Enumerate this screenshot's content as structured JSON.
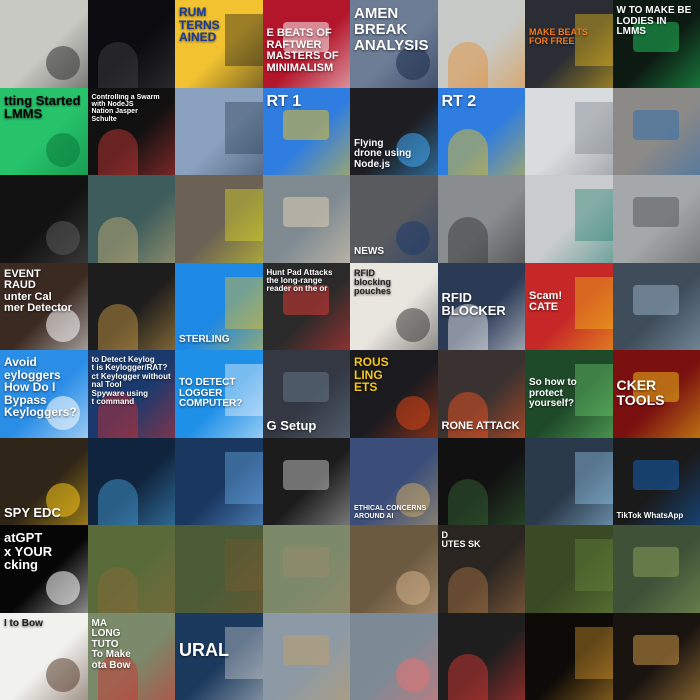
{
  "grid": {
    "columns": 8,
    "rows": 8,
    "tiles": [
      {
        "id": "r1c1",
        "label": "",
        "bg": "#c9c9c4",
        "accent": "#333333",
        "text_color": "#000000",
        "pos": "center",
        "size": 10
      },
      {
        "id": "r1c2",
        "label": "",
        "bg": "#0c0c10",
        "accent": "#444444",
        "text_color": "#ffffff",
        "pos": "center",
        "size": 10
      },
      {
        "id": "r1c3",
        "label": "RUM\nTERNS\nAINED",
        "bg": "#f2c230",
        "accent": "#1a1a1a",
        "text_color": "#1b3b9a",
        "pos": "top",
        "size": 12
      },
      {
        "id": "r1c4",
        "label": "E BEATS OF\nRAFTWER\nMASTERS OF MINIMALISM",
        "bg": "#b3162b",
        "accent": "#ffffff",
        "text_color": "#ffffff",
        "pos": "mid",
        "size": 11
      },
      {
        "id": "r1c5",
        "label": "AMEN\nBREAK\nANALYSIS",
        "bg": "#6d7d96",
        "accent": "#1b2c4a",
        "text_color": "#ffffff",
        "pos": "top",
        "size": 15
      },
      {
        "id": "r1c6",
        "label": "",
        "bg": "#c7cac6",
        "accent": "#e58a2c",
        "text_color": "#000000",
        "pos": "center",
        "size": 10
      },
      {
        "id": "r1c7",
        "label": "MAKE BEATS FOR FREE",
        "bg": "#2a2d33",
        "accent": "#f5c518",
        "text_color": "#f07c1c",
        "pos": "mid",
        "size": 9
      },
      {
        "id": "r1c8",
        "label": "W TO MAKE BE\nLODIES IN LMMS",
        "bg": "#0d1a12",
        "accent": "#22c55e",
        "text_color": "#ffffff",
        "pos": "top",
        "size": 10
      },
      {
        "id": "r2c1",
        "label": "tting Started\nLMMS",
        "bg": "#27c36b",
        "accent": "#0a7a3a",
        "text_color": "#000000",
        "pos": "top",
        "size": 13
      },
      {
        "id": "r2c2",
        "label": "Controlling a Swarm\nwith NodeJS\nNation  Jasper\nSchulte",
        "bg": "#111111",
        "accent": "#d63a3a",
        "text_color": "#ffffff",
        "pos": "top",
        "size": 7
      },
      {
        "id": "r2c3",
        "label": "",
        "bg": "#8aa1bf",
        "accent": "#2b3c55",
        "text_color": "#ffffff",
        "pos": "center",
        "size": 10
      },
      {
        "id": "r2c4",
        "label": "RT 1",
        "bg": "#2f7de0",
        "accent": "#f5c518",
        "text_color": "#ffffff",
        "pos": "top",
        "size": 16
      },
      {
        "id": "r2c5",
        "label": "Flying\ndrone using\nNode.js",
        "bg": "#1d1d22",
        "accent": "#3fa9f5",
        "text_color": "#ffffff",
        "pos": "bottom",
        "size": 10
      },
      {
        "id": "r2c6",
        "label": "RT 2",
        "bg": "#2f7de0",
        "accent": "#f5c518",
        "text_color": "#ffffff",
        "pos": "top",
        "size": 16
      },
      {
        "id": "r2c7",
        "label": "",
        "bg": "#d8dcdf",
        "accent": "#7a7f85",
        "text_color": "#000000",
        "pos": "center",
        "size": 10
      },
      {
        "id": "r2c8",
        "label": "",
        "bg": "#8c8a86",
        "accent": "#2b6cb0",
        "text_color": "#000000",
        "pos": "center",
        "size": 10
      },
      {
        "id": "r3c1",
        "label": "",
        "bg": "#121212",
        "accent": "#5a5a5a",
        "text_color": "#ffffff",
        "pos": "center",
        "size": 10
      },
      {
        "id": "r3c2",
        "label": "",
        "bg": "#3d5c5b",
        "accent": "#c9b37a",
        "text_color": "#ffffff",
        "pos": "center",
        "size": 10
      },
      {
        "id": "r3c3",
        "label": "",
        "bg": "#6b6255",
        "accent": "#e4e021",
        "text_color": "#ffffff",
        "pos": "center",
        "size": 10
      },
      {
        "id": "r3c4",
        "label": "",
        "bg": "#7f8b91",
        "accent": "#e7d3b8",
        "text_color": "#ffffff",
        "pos": "center",
        "size": 10
      },
      {
        "id": "r3c5",
        "label": "NEWS",
        "bg": "#585a5e",
        "accent": "#1f3b6b",
        "text_color": "#ffffff",
        "pos": "bottom",
        "size": 10
      },
      {
        "id": "r3c6",
        "label": "",
        "bg": "#8a8d90",
        "accent": "#2c2c2c",
        "text_color": "#ffffff",
        "pos": "center",
        "size": 10
      },
      {
        "id": "r3c7",
        "label": "",
        "bg": "#c9cbcc",
        "accent": "#1e7f6e",
        "text_color": "#ffffff",
        "pos": "center",
        "size": 10
      },
      {
        "id": "r3c8",
        "label": "",
        "bg": "#a5a8aa",
        "accent": "#505050",
        "text_color": "#ffffff",
        "pos": "center",
        "size": 10
      },
      {
        "id": "r4c1",
        "label": "EVENT\nRAUD\nunter Cal\nmer Detector",
        "bg": "#3b2a22",
        "accent": "#ffffff",
        "text_color": "#ffffff",
        "pos": "top",
        "size": 11
      },
      {
        "id": "r4c2",
        "label": "",
        "bg": "#1d1d1d",
        "accent": "#d7a44a",
        "text_color": "#ffffff",
        "pos": "center",
        "size": 10
      },
      {
        "id": "r4c3",
        "label": "STERLING",
        "bg": "#1e88e5",
        "accent": "#f5c518",
        "text_color": "#ffffff",
        "pos": "bottom",
        "size": 10
      },
      {
        "id": "r4c4",
        "label": "Hunt Pad Attacks\nthe long-range reader on the or",
        "bg": "#2a2a2a",
        "accent": "#e53935",
        "text_color": "#ffffff",
        "pos": "top",
        "size": 8
      },
      {
        "id": "r4c5",
        "label": "RFID\nblocking\npouches",
        "bg": "#e9e6e0",
        "accent": "#3a3a3a",
        "text_color": "#222222",
        "pos": "top",
        "size": 9
      },
      {
        "id": "r4c6",
        "label": "RFID BLOCKER",
        "bg": "#2b3a55",
        "accent": "#ffffff",
        "text_color": "#ffffff",
        "pos": "mid",
        "size": 13
      },
      {
        "id": "r4c7",
        "label": "Scam!\nCATE",
        "bg": "#c62828",
        "accent": "#f5c518",
        "text_color": "#ffffff",
        "pos": "mid",
        "size": 11
      },
      {
        "id": "r4c8",
        "label": "",
        "bg": "#3f4d5a",
        "accent": "#9bb4c8",
        "text_color": "#ffffff",
        "pos": "center",
        "size": 10
      },
      {
        "id": "r5c1",
        "label": "Avoid\neyloggers\nHow Do I Bypass Keyloggers?",
        "bg": "#2b8ee6",
        "accent": "#ffffff",
        "text_color": "#ffffff",
        "pos": "top",
        "size": 12
      },
      {
        "id": "r5c2",
        "label": "to Detect Keylog\nt is Keylogger/RAT?\nct Keylogger without\nnal Tool\nSpyware using\nt command",
        "bg": "#1a3a6e",
        "accent": "#d32f2f",
        "text_color": "#ffffff",
        "pos": "top",
        "size": 8
      },
      {
        "id": "r5c3",
        "label": "TO DETECT\nLOGGER\nCOMPUTER?",
        "bg": "#1f90e8",
        "accent": "#ffffff",
        "text_color": "#ffffff",
        "pos": "mid",
        "size": 10
      },
      {
        "id": "r5c4",
        "label": "G Setup",
        "bg": "#333842",
        "accent": "#6a7a8c",
        "text_color": "#ffffff",
        "pos": "bottom",
        "size": 13
      },
      {
        "id": "r5c5",
        "label": "ROUS\nLING\nETS",
        "bg": "#1b1b1f",
        "accent": "#d84315",
        "text_color": "#f5c518",
        "pos": "top",
        "size": 12
      },
      {
        "id": "r5c6",
        "label": "RONE ATTACK",
        "bg": "#3a3230",
        "accent": "#ff5722",
        "text_color": "#ffffff",
        "pos": "bottom",
        "size": 11
      },
      {
        "id": "r5c7",
        "label": "So how to\nprotect\nyourself?",
        "bg": "#1f4a2a",
        "accent": "#6fd36f",
        "text_color": "#ffffff",
        "pos": "mid",
        "size": 10
      },
      {
        "id": "r5c8",
        "label": "CKER TOOLS",
        "bg": "#7a1010",
        "accent": "#f5c518",
        "text_color": "#ffffff",
        "pos": "mid",
        "size": 14
      },
      {
        "id": "r6c1",
        "label": "SPY EDC",
        "bg": "#2f2518",
        "accent": "#f5c518",
        "text_color": "#ffffff",
        "pos": "bottom",
        "size": 13
      },
      {
        "id": "r6c2",
        "label": "",
        "bg": "#10253d",
        "accent": "#4aa3df",
        "text_color": "#ffffff",
        "pos": "center",
        "size": 10
      },
      {
        "id": "r6c3",
        "label": "",
        "bg": "#1a3760",
        "accent": "#6db3f2",
        "text_color": "#ffffff",
        "pos": "center",
        "size": 10
      },
      {
        "id": "r6c4",
        "label": "",
        "bg": "#1c1c1c",
        "accent": "#c8c8c8",
        "text_color": "#ffffff",
        "pos": "center",
        "size": 10
      },
      {
        "id": "r6c5",
        "label": "ETHICAL CONCERNS AROUND AI",
        "bg": "#3b4e7a",
        "accent": "#c8a86a",
        "text_color": "#ffffff",
        "pos": "bottom",
        "size": 7
      },
      {
        "id": "r6c6",
        "label": "",
        "bg": "#111111",
        "accent": "#3a6b3a",
        "text_color": "#ffffff",
        "pos": "center",
        "size": 10
      },
      {
        "id": "r6c7",
        "label": "",
        "bg": "#2b3a4a",
        "accent": "#9ad0f5",
        "text_color": "#ffffff",
        "pos": "center",
        "size": 10
      },
      {
        "id": "r6c8",
        "label": "TikTok  WhatsApp",
        "bg": "#1a1a1a",
        "accent": "#1565c0",
        "text_color": "#ffffff",
        "pos": "bottom",
        "size": 8
      },
      {
        "id": "r7c1",
        "label": "atGPT\nx YOUR\ncking",
        "bg": "#060606",
        "accent": "#ffffff",
        "text_color": "#ffffff",
        "pos": "top",
        "size": 13
      },
      {
        "id": "r7c2",
        "label": "",
        "bg": "#5a6b3a",
        "accent": "#8b6a3a",
        "text_color": "#ffffff",
        "pos": "center",
        "size": 10
      },
      {
        "id": "r7c3",
        "label": "",
        "bg": "#4a5b35",
        "accent": "#7a5a33",
        "text_color": "#ffffff",
        "pos": "center",
        "size": 10
      },
      {
        "id": "r7c4",
        "label": "",
        "bg": "#7c8a6a",
        "accent": "#9a8a6a",
        "text_color": "#ffffff",
        "pos": "center",
        "size": 10
      },
      {
        "id": "r7c5",
        "label": "",
        "bg": "#6c5a40",
        "accent": "#d2b08a",
        "text_color": "#ffffff",
        "pos": "center",
        "size": 10
      },
      {
        "id": "r7c6",
        "label": "D\nUTES          SK",
        "bg": "#2a2520",
        "accent": "#b07a4a",
        "text_color": "#ffffff",
        "pos": "top",
        "size": 9
      },
      {
        "id": "r7c7",
        "label": "",
        "bg": "#3a4a25",
        "accent": "#6b8a3a",
        "text_color": "#ffffff",
        "pos": "center",
        "size": 10
      },
      {
        "id": "r7c8",
        "label": "",
        "bg": "#3f5238",
        "accent": "#8ba05a",
        "text_color": "#ffffff",
        "pos": "center",
        "size": 10
      },
      {
        "id": "r8c1",
        "label": "l to Bow",
        "bg": "#f1f1ee",
        "accent": "#5a4030",
        "text_color": "#222222",
        "pos": "top",
        "size": 10
      },
      {
        "id": "r8c2",
        "label": "MA\nLONG\nTUTO\nTo Make\nota Bow",
        "bg": "#7a8a6a",
        "accent": "#d32f2f",
        "text_color": "#ffffff",
        "pos": "top",
        "size": 10
      },
      {
        "id": "r8c3",
        "label": "URAL",
        "bg": "#1b3a5e",
        "accent": "#d8d8d8",
        "text_color": "#ffffff",
        "pos": "mid",
        "size": 18
      },
      {
        "id": "r8c4",
        "label": "",
        "bg": "#8d9aa5",
        "accent": "#c2a06a",
        "text_color": "#ffffff",
        "pos": "center",
        "size": 10
      },
      {
        "id": "r8c5",
        "label": "",
        "bg": "#7d8a95",
        "accent": "#e57373",
        "text_color": "#ffffff",
        "pos": "center",
        "size": 10
      },
      {
        "id": "r8c6",
        "label": "",
        "bg": "#1e1e1e",
        "accent": "#e53935",
        "text_color": "#ffffff",
        "pos": "center",
        "size": 10
      },
      {
        "id": "r8c7",
        "label": "",
        "bg": "#0d0a08",
        "accent": "#e0a030",
        "text_color": "#ffffff",
        "pos": "center",
        "size": 10
      },
      {
        "id": "r8c8",
        "label": "",
        "bg": "#1a1410",
        "accent": "#d8a04a",
        "text_color": "#ffffff",
        "pos": "center",
        "size": 10
      }
    ]
  }
}
